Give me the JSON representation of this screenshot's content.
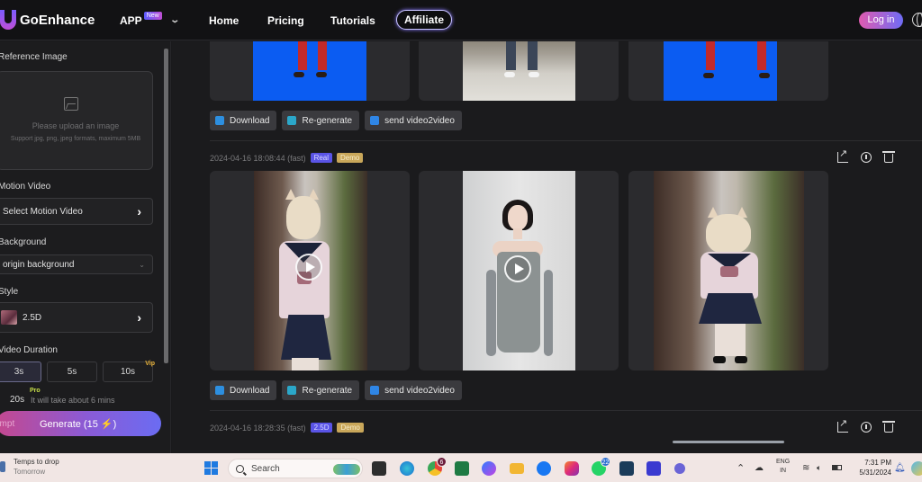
{
  "header": {
    "brand": "GoEnhance",
    "nav": {
      "app": "APP",
      "app_badge": "New",
      "home": "Home",
      "pricing": "Pricing",
      "tutorials": "Tutorials",
      "affiliate": "Affiliate"
    },
    "login": "Log in"
  },
  "sidebar": {
    "reference_image": {
      "label": "Reference Image",
      "upload_hint": "Please upload an image",
      "upload_formats": "Support jpg, png, jpeg formats, maximum 5MB"
    },
    "motion_video": {
      "label": "Motion Video",
      "value": "Select Motion Video"
    },
    "background": {
      "label": "Background",
      "value": "origin background"
    },
    "style": {
      "label": "Style",
      "value": "2.5D"
    },
    "video_duration": {
      "label": "Video Duration",
      "options": [
        "3s",
        "5s",
        "10s",
        "20s"
      ],
      "selected": "3s",
      "vip_tag": "Vip",
      "pro_tag": "Pro",
      "note": "It will take about 6 mins"
    },
    "prompt_label": "Prompt",
    "generate": "Generate (15 ⚡)"
  },
  "main": {
    "actions": {
      "download": "Download",
      "regenerate": "Re-generate",
      "send": "send video2video"
    },
    "entries": [
      {
        "timestamp": "",
        "tags": []
      },
      {
        "timestamp": "2024-04-16 18:08:44 (fast)",
        "tags": [
          "Real",
          "Demo"
        ]
      },
      {
        "timestamp": "2024-04-16 18:28:35 (fast)",
        "tags": [
          "2.5D",
          "Demo"
        ]
      }
    ]
  },
  "taskbar": {
    "weather_title": "Temps to drop",
    "weather_sub": "Tomorrow",
    "search_placeholder": "Search",
    "chrome_badge": "6",
    "whatsapp_badge": "22",
    "lang_top": "ENG",
    "lang_bottom": "IN",
    "time": "7:31 PM",
    "date": "5/31/2024"
  },
  "colors": {
    "accent_gradient_start": "#e05bb0",
    "accent_gradient_end": "#6f6cf6",
    "style_badge": "#5a54e6",
    "demo_badge": "#c9a75a",
    "background": "#1b1b1d"
  }
}
